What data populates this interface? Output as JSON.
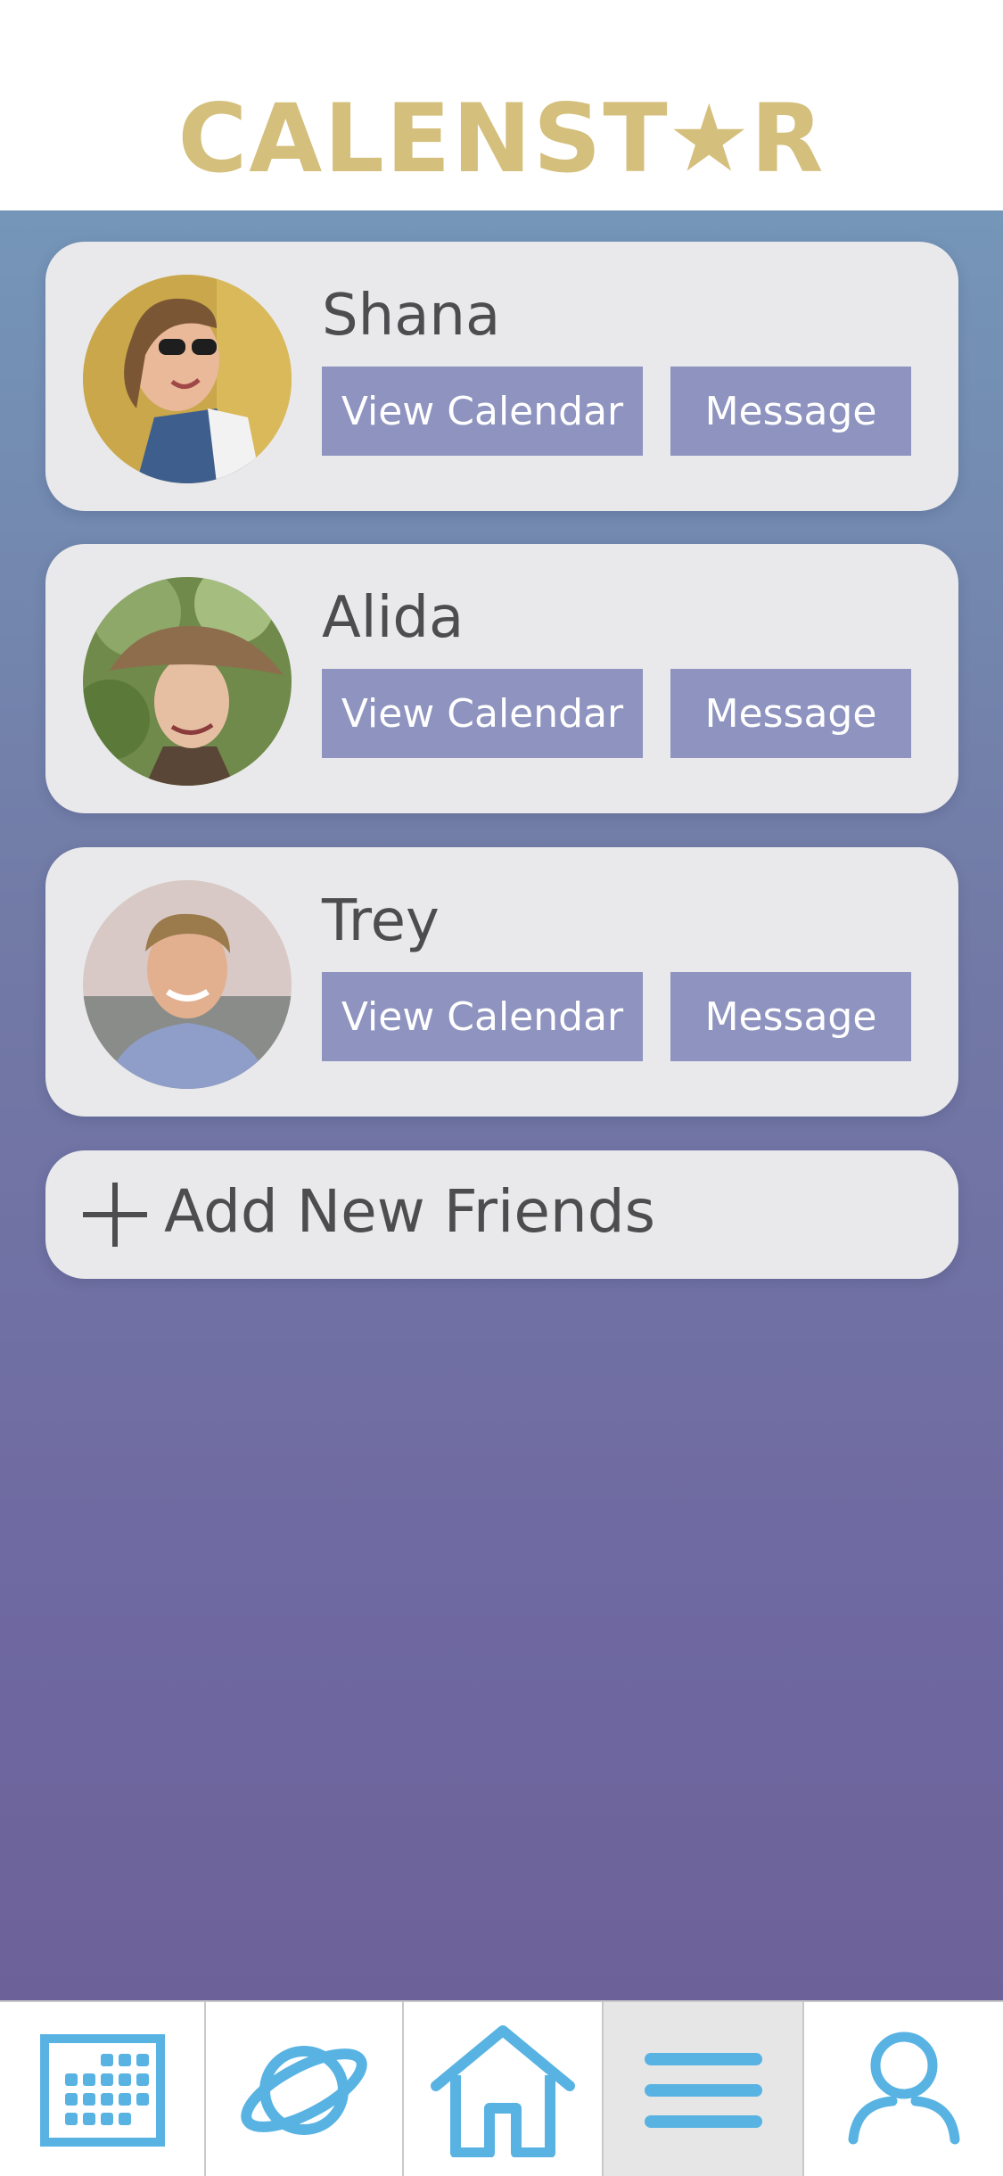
{
  "app": {
    "logo_prefix": "CALENST",
    "logo_suffix": "R",
    "logo_star": "★"
  },
  "friends": [
    {
      "name": "Shana",
      "view_label": "View Calendar",
      "message_label": "Message"
    },
    {
      "name": "Alida",
      "view_label": "View Calendar",
      "message_label": "Message"
    },
    {
      "name": "Trey",
      "view_label": "View Calendar",
      "message_label": "Message"
    }
  ],
  "add_friends": {
    "label": "Add New Friends"
  },
  "nav": {
    "items": [
      {
        "icon": "calendar-icon",
        "active": false
      },
      {
        "icon": "planet-icon",
        "active": false
      },
      {
        "icon": "home-icon",
        "active": false
      },
      {
        "icon": "menu-icon",
        "active": true
      },
      {
        "icon": "profile-icon",
        "active": false
      }
    ]
  },
  "colors": {
    "logo_gold": "#d4bf7c",
    "button": "#8e93bf",
    "card": "#e9e9eb",
    "nav_icon": "#58b3e3",
    "gradient_top": "#7596b8",
    "gradient_bottom": "#6d6199"
  }
}
